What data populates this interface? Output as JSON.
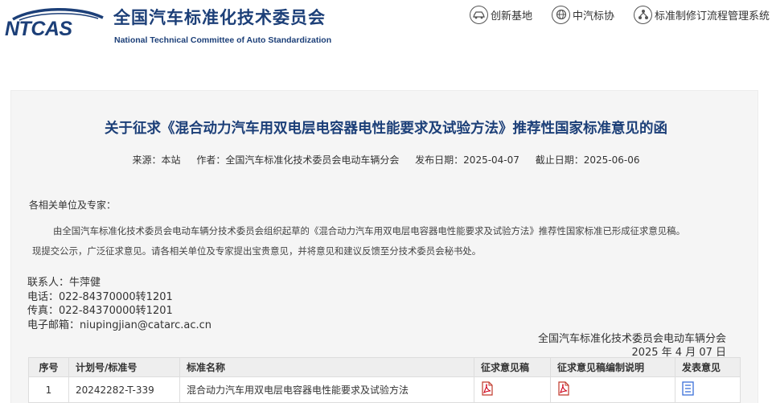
{
  "header": {
    "logo_text": "NTCAS",
    "title_cn": "全国汽车标准化技术委员会",
    "title_en": "National Technical Committee of Auto Standardization",
    "nav": [
      {
        "label": "创新基地",
        "icon": "car-icon"
      },
      {
        "label": "中汽标协",
        "icon": "globe-icon"
      },
      {
        "label": "标准制修订流程管理系统",
        "icon": "network-icon"
      }
    ]
  },
  "article": {
    "title": "关于征求《混合动力汽车用双电层电容器电性能要求及试验方法》推荐性国家标准意见的函",
    "meta": {
      "source": "来源：本站",
      "author": "作者：全国汽车标准化技术委员会电动车辆分会",
      "publish_date": "发布日期：2025-04-07",
      "deadline": "截止日期：2025-06-06"
    },
    "greeting": "各相关单位及专家：",
    "body_line1": "由全国汽车标准化技术委员会电动车辆分技术委员会组织起草的《混合动力汽车用双电层电容器电性能要求及试验方法》推荐性国家标准已形成征求意见稿。",
    "body_line2": "现提交公示，广泛征求意见。请各相关单位及专家提出宝贵意见，并将意见和建议反馈至分技术委员会秘书处。",
    "contact": {
      "person": "联系人：牛萍健",
      "phone": "电话：022-84370000转1201",
      "fax": "传真：022-84370000转1201",
      "email": "电子邮箱：niupingjian@catarc.ac.cn"
    },
    "signature_org": "全国汽车标准化技术委员会电动车辆分会",
    "signature_date": "2025 年 4 月 07 日"
  },
  "table": {
    "headers": [
      "序号",
      "计划号/标准号",
      "标准名称",
      "征求意见稿",
      "征求意见稿编制说明",
      "发表意见"
    ],
    "rows": [
      {
        "seq": "1",
        "plan_no": "20242282-T-339",
        "name": "混合动力汽车用双电层电容器电性能要求及试验方法"
      }
    ]
  },
  "colors": {
    "brand_blue": "#1c3f78",
    "pdf_red": "#d0021b",
    "comment_blue": "#3a6fd8"
  }
}
